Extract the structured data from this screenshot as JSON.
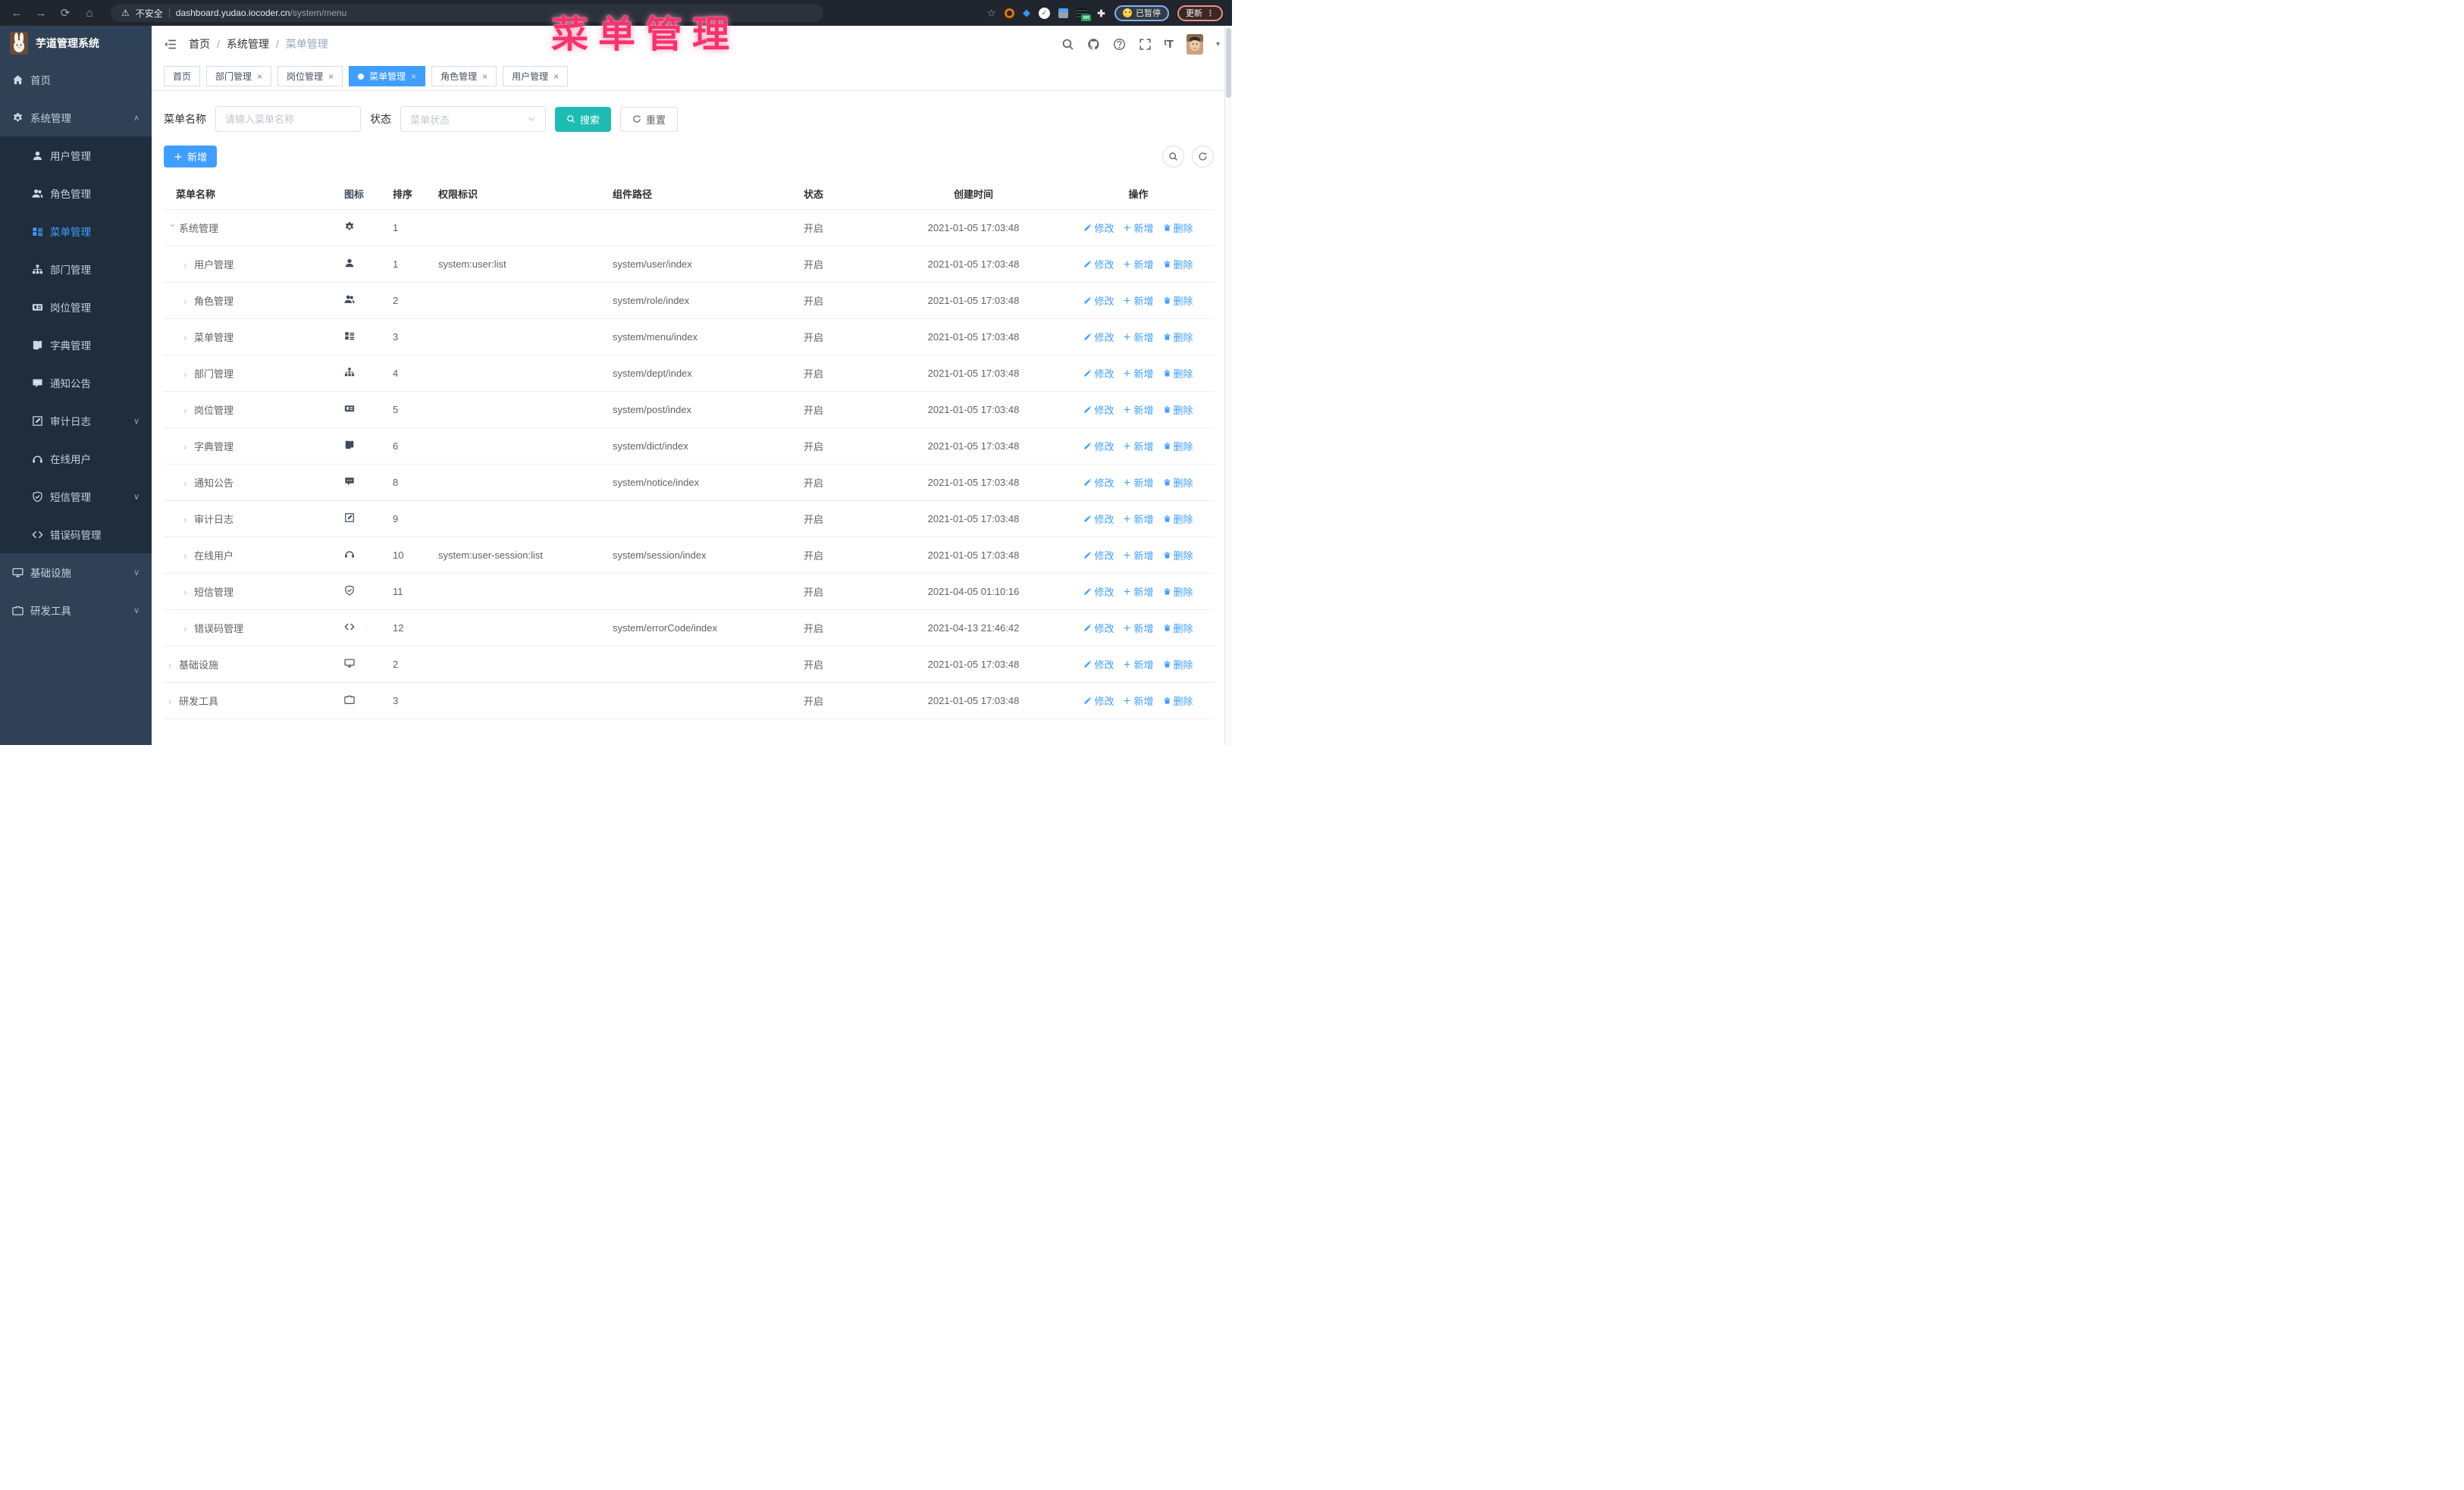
{
  "browser": {
    "security_label": "不安全",
    "url_host": "dashboard.yudao.iocoder.cn",
    "url_path": "/system/menu",
    "paused_label": "已暂停",
    "update_label": "更新",
    "extension_on_label": "on",
    "menu_dots": "⋮"
  },
  "overlay": {
    "title": "菜单管理",
    "color": "#f5336e"
  },
  "app": {
    "title": "芋道管理系统"
  },
  "breadcrumb": [
    "首页",
    "系统管理",
    "菜单管理"
  ],
  "tabs": [
    {
      "label": "首页",
      "closable": false,
      "active": false
    },
    {
      "label": "部门管理",
      "closable": true,
      "active": false
    },
    {
      "label": "岗位管理",
      "closable": true,
      "active": false
    },
    {
      "label": "菜单管理",
      "closable": true,
      "active": true
    },
    {
      "label": "角色管理",
      "closable": true,
      "active": false
    },
    {
      "label": "用户管理",
      "closable": true,
      "active": false
    }
  ],
  "sidebar": {
    "items": [
      {
        "label": "首页",
        "icon": "home",
        "level": 0
      },
      {
        "label": "系统管理",
        "icon": "gear",
        "level": 0,
        "caret": "up"
      },
      {
        "label": "用户管理",
        "icon": "user",
        "level": 1
      },
      {
        "label": "角色管理",
        "icon": "users",
        "level": 1
      },
      {
        "label": "菜单管理",
        "icon": "menu",
        "level": 1,
        "active": true
      },
      {
        "label": "部门管理",
        "icon": "tree",
        "level": 1
      },
      {
        "label": "岗位管理",
        "icon": "badge",
        "level": 1
      },
      {
        "label": "字典管理",
        "icon": "book",
        "level": 1
      },
      {
        "label": "通知公告",
        "icon": "chat",
        "level": 1
      },
      {
        "label": "审计日志",
        "icon": "edit",
        "level": 1,
        "caret": "down"
      },
      {
        "label": "在线用户",
        "icon": "headset",
        "level": 1
      },
      {
        "label": "短信管理",
        "icon": "shield",
        "level": 1,
        "caret": "down"
      },
      {
        "label": "错误码管理",
        "icon": "code",
        "level": 1
      },
      {
        "label": "基础设施",
        "icon": "monitor",
        "level": 0,
        "caret": "down"
      },
      {
        "label": "研发工具",
        "icon": "briefcase",
        "level": 0,
        "caret": "down"
      }
    ]
  },
  "header_icons": [
    "magnifier",
    "github",
    "help",
    "fullscreen"
  ],
  "search": {
    "name_label": "菜单名称",
    "name_placeholder": "请输入菜单名称",
    "status_label": "状态",
    "status_placeholder": "菜单状态",
    "search_button": "搜索",
    "reset_button": "重置"
  },
  "toolbar": {
    "add_button": "新增"
  },
  "table": {
    "headers": [
      "菜单名称",
      "图标",
      "排序",
      "权限标识",
      "组件路径",
      "状态",
      "创建时间",
      "操作"
    ],
    "op_labels": {
      "edit": "修改",
      "add": "新增",
      "delete": "删除"
    },
    "rows": [
      {
        "name": "系统管理",
        "icon": "gear",
        "level": 0,
        "expanded": true,
        "sort": "1",
        "perm": "",
        "path": "",
        "status": "开启",
        "time": "2021-01-05 17:03:48"
      },
      {
        "name": "用户管理",
        "icon": "user",
        "level": 1,
        "expanded": false,
        "sort": "1",
        "perm": "system:user:list",
        "path": "system/user/index",
        "status": "开启",
        "time": "2021-01-05 17:03:48"
      },
      {
        "name": "角色管理",
        "icon": "users",
        "level": 1,
        "expanded": false,
        "sort": "2",
        "perm": "",
        "path": "system/role/index",
        "status": "开启",
        "time": "2021-01-05 17:03:48"
      },
      {
        "name": "菜单管理",
        "icon": "menu",
        "level": 1,
        "expanded": false,
        "sort": "3",
        "perm": "",
        "path": "system/menu/index",
        "status": "开启",
        "time": "2021-01-05 17:03:48"
      },
      {
        "name": "部门管理",
        "icon": "tree",
        "level": 1,
        "expanded": false,
        "sort": "4",
        "perm": "",
        "path": "system/dept/index",
        "status": "开启",
        "time": "2021-01-05 17:03:48"
      },
      {
        "name": "岗位管理",
        "icon": "badge",
        "level": 1,
        "expanded": false,
        "sort": "5",
        "perm": "",
        "path": "system/post/index",
        "status": "开启",
        "time": "2021-01-05 17:03:48"
      },
      {
        "name": "字典管理",
        "icon": "book",
        "level": 1,
        "expanded": false,
        "sort": "6",
        "perm": "",
        "path": "system/dict/index",
        "status": "开启",
        "time": "2021-01-05 17:03:48"
      },
      {
        "name": "通知公告",
        "icon": "chat",
        "level": 1,
        "expanded": false,
        "sort": "8",
        "perm": "",
        "path": "system/notice/index",
        "status": "开启",
        "time": "2021-01-05 17:03:48"
      },
      {
        "name": "审计日志",
        "icon": "edit",
        "level": 1,
        "expanded": false,
        "sort": "9",
        "perm": "",
        "path": "",
        "status": "开启",
        "time": "2021-01-05 17:03:48"
      },
      {
        "name": "在线用户",
        "icon": "headset",
        "level": 1,
        "expanded": false,
        "sort": "10",
        "perm": "system:user-session:list",
        "path": "system/session/index",
        "status": "开启",
        "time": "2021-01-05 17:03:48"
      },
      {
        "name": "短信管理",
        "icon": "shield",
        "level": 1,
        "expanded": false,
        "sort": "11",
        "perm": "",
        "path": "",
        "status": "开启",
        "time": "2021-04-05 01:10:16"
      },
      {
        "name": "错误码管理",
        "icon": "code",
        "level": 1,
        "expanded": false,
        "sort": "12",
        "perm": "",
        "path": "system/errorCode/index",
        "status": "开启",
        "time": "2021-04-13 21:46:42"
      },
      {
        "name": "基础设施",
        "icon": "monitor",
        "level": 0,
        "expanded": false,
        "sort": "2",
        "perm": "",
        "path": "",
        "status": "开启",
        "time": "2021-01-05 17:03:48"
      },
      {
        "name": "研发工具",
        "icon": "briefcase",
        "level": 0,
        "expanded": false,
        "sort": "3",
        "perm": "",
        "path": "",
        "status": "开启",
        "time": "2021-01-05 17:03:48"
      }
    ]
  },
  "colors": {
    "accent_blue": "#409eff",
    "search_teal": "#1fbcb4",
    "sidebar_bg": "#304156",
    "submenu_bg": "#1f2d3d",
    "chrome_bg": "#21262e",
    "overlay_pink": "#f5336e"
  }
}
